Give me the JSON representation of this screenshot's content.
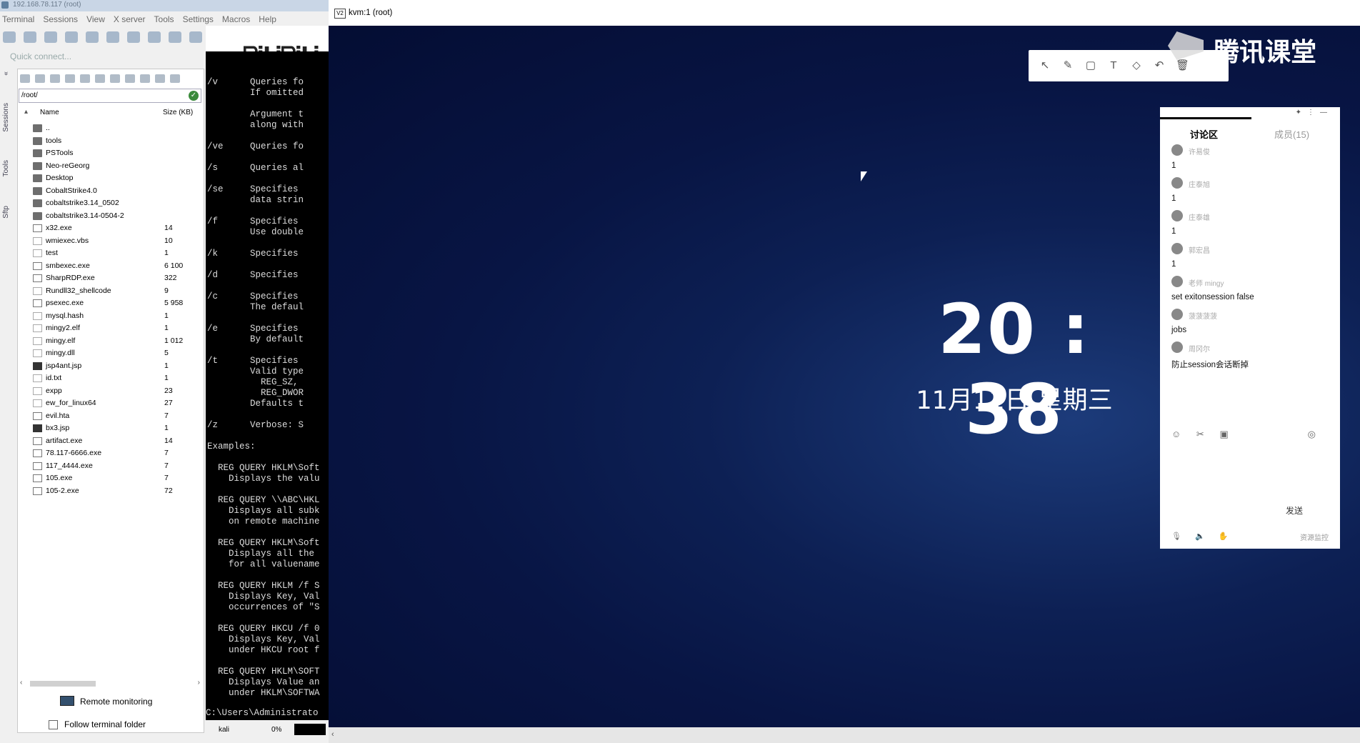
{
  "left_app": {
    "title": "192.168.78.117 (root)",
    "menu": [
      "Terminal",
      "Sessions",
      "View",
      "X server",
      "Tools",
      "Settings",
      "Macros",
      "Help"
    ],
    "quick_connect_placeholder": "Quick connect...",
    "side_tabs": [
      "Sessions",
      "Tools",
      "Sftp"
    ]
  },
  "file_browser": {
    "path": "/root/",
    "columns": {
      "name": "Name",
      "size": "Size (KB)"
    },
    "files": [
      {
        "name": "..",
        "size": "",
        "type": "up"
      },
      {
        "name": "tools",
        "size": "",
        "type": "folder"
      },
      {
        "name": "PSTools",
        "size": "",
        "type": "folder"
      },
      {
        "name": "Neo-reGeorg",
        "size": "",
        "type": "folder"
      },
      {
        "name": "Desktop",
        "size": "",
        "type": "folder"
      },
      {
        "name": "CobaltStrike4.0",
        "size": "",
        "type": "folder"
      },
      {
        "name": "cobaltstrike3.14_0502",
        "size": "",
        "type": "folder"
      },
      {
        "name": "cobaltstrike3.14-0504-2",
        "size": "",
        "type": "folder"
      },
      {
        "name": "x32.exe",
        "size": "14",
        "type": "exe"
      },
      {
        "name": "wmiexec.vbs",
        "size": "10",
        "type": "doc"
      },
      {
        "name": "test",
        "size": "1",
        "type": "doc"
      },
      {
        "name": "smbexec.exe",
        "size": "6 100",
        "type": "exe"
      },
      {
        "name": "SharpRDP.exe",
        "size": "322",
        "type": "exe"
      },
      {
        "name": "Rundll32_shellcode",
        "size": "9",
        "type": "doc"
      },
      {
        "name": "psexec.exe",
        "size": "5 958",
        "type": "exe"
      },
      {
        "name": "mysql.hash",
        "size": "1",
        "type": "doc"
      },
      {
        "name": "mingy2.elf",
        "size": "1",
        "type": "doc"
      },
      {
        "name": "mingy.elf",
        "size": "1 012",
        "type": "doc"
      },
      {
        "name": "mingy.dll",
        "size": "5",
        "type": "doc"
      },
      {
        "name": "jsp4ant.jsp",
        "size": "1",
        "type": "jsp"
      },
      {
        "name": "id.txt",
        "size": "1",
        "type": "doc"
      },
      {
        "name": "expp",
        "size": "23",
        "type": "doc"
      },
      {
        "name": "ew_for_linux64",
        "size": "27",
        "type": "doc"
      },
      {
        "name": "evil.hta",
        "size": "7",
        "type": "exe"
      },
      {
        "name": "bx3.jsp",
        "size": "1",
        "type": "jsp"
      },
      {
        "name": "artifact.exe",
        "size": "14",
        "type": "exe"
      },
      {
        "name": "78.117-6666.exe",
        "size": "7",
        "type": "exe"
      },
      {
        "name": "117_4444.exe",
        "size": "7",
        "type": "exe"
      },
      {
        "name": "105.exe",
        "size": "7",
        "type": "exe"
      },
      {
        "name": "105-2.exe",
        "size": "72",
        "type": "exe"
      }
    ],
    "remote_monitoring": "Remote monitoring",
    "follow_terminal": "Follow terminal folder"
  },
  "terminal": {
    "lines": "/v      Queries fo\n        If omitted\n\n        Argument t\n        along with\n\n/ve     Queries fo\n\n/s      Queries al\n\n/se     Specifies\n        data strin\n\n/f      Specifies\n        Use double\n\n/k      Specifies\n\n/d      Specifies\n\n/c      Specifies\n        The defaul\n\n/e      Specifies\n        By default\n\n/t      Specifies\n        Valid type\n          REG_SZ,\n          REG_DWOR\n        Defaults t\n\n/z      Verbose: S\n\nExamples:\n\n  REG QUERY HKLM\\Soft\n    Displays the valu\n\n  REG QUERY \\\\ABC\\HKL\n    Displays all subk\n    on remote machine\n\n  REG QUERY HKLM\\Soft\n    Displays all the\n    for all valuename\n\n  REG QUERY HKLM /f S\n    Displays Key, Val\n    occurrences of \"S\n\n  REG QUERY HKCU /f 0\n    Displays Key, Val\n    under HKCU root f\n\n  REG QUERY HKLM\\SOFT\n    Displays Value an\n    under HKLM\\SOFTWA",
    "prompt": "C:\\Users\\Administrato",
    "status_host": "kali",
    "status_pct": "0%"
  },
  "vnc": {
    "title": "kvm:1 (root)",
    "time": "20 : 38",
    "date": "11月11日 星期三"
  },
  "tencent": {
    "logo_text": "腾讯课堂",
    "tab_discussion": "讨论区",
    "tab_members": "成员(15)",
    "messages": [
      {
        "name": "许易俊",
        "text": "1"
      },
      {
        "name": "庄泰旭",
        "text": "1"
      },
      {
        "name": "庄泰雄",
        "text": "1"
      },
      {
        "name": "郭宏昌",
        "text": "1"
      },
      {
        "name": "老师 mingy",
        "text": "set exitonsession false"
      },
      {
        "name": "菠菠菠菠",
        "text": "jobs"
      },
      {
        "name": "周冈尔",
        "text": "防止session会话断掉"
      }
    ],
    "send": "发送",
    "bottom_right": "资源监控"
  },
  "colors": {
    "desktop_blue": "#0d2054",
    "terminal_bg": "#000000"
  }
}
